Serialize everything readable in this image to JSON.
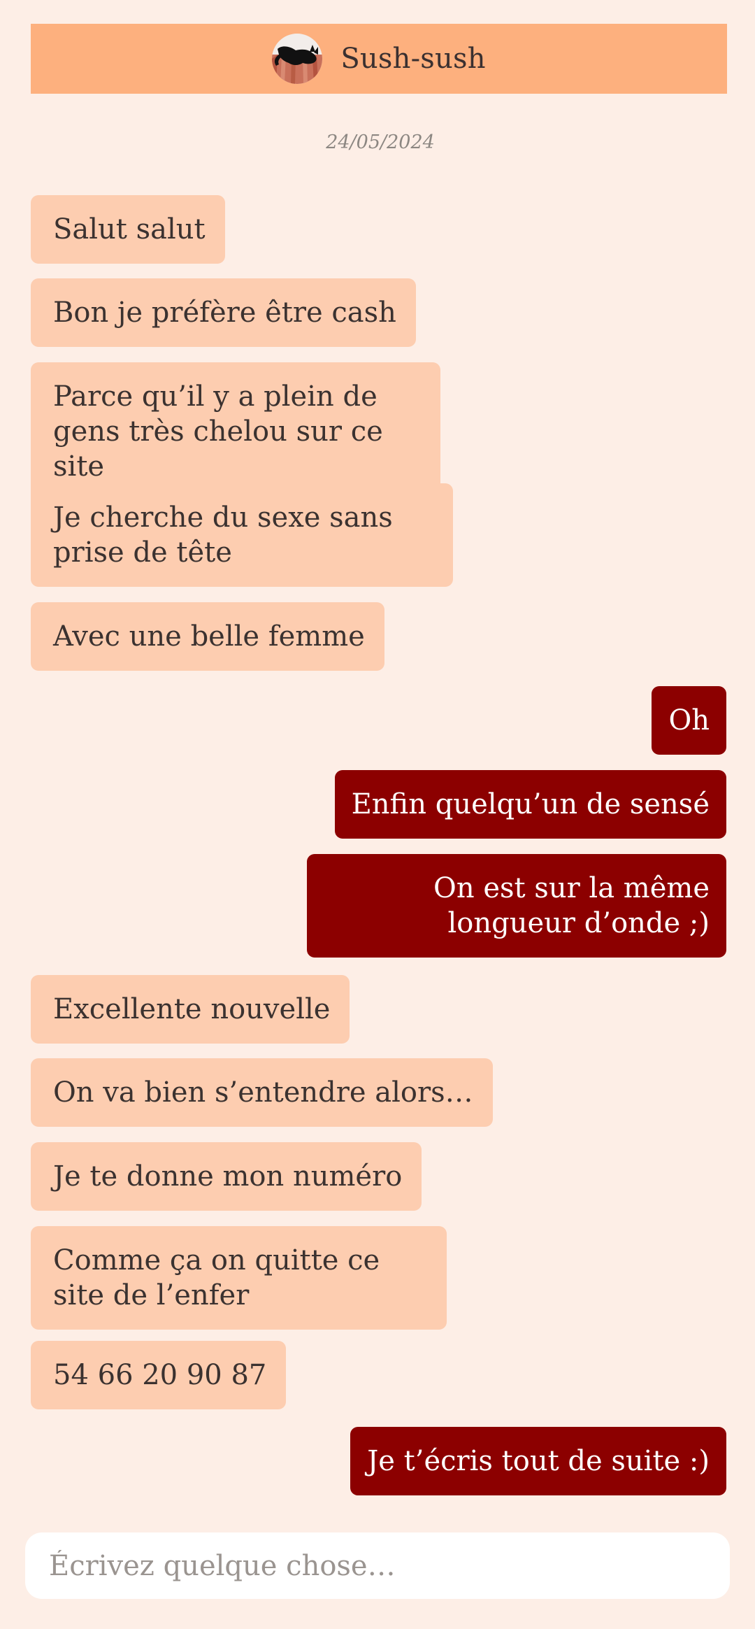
{
  "header": {
    "contact_name": "Sush-sush",
    "avatar_icon": "cat-avatar-icon"
  },
  "conversation": {
    "date": "24/05/2024",
    "messages": [
      {
        "from": "them",
        "text": "Salut salut"
      },
      {
        "from": "them",
        "text": "Bon je préfère être cash"
      },
      {
        "from": "them",
        "text": "Parce qu’il y a plein de gens très chelou sur ce site"
      },
      {
        "from": "them",
        "text": "Je cherche du sexe sans prise de tête"
      },
      {
        "from": "them",
        "text": "Avec une belle femme"
      },
      {
        "from": "me",
        "text": "Oh"
      },
      {
        "from": "me",
        "text": "Enfin quelqu’un de sensé"
      },
      {
        "from": "me",
        "text": "On est sur la même longueur d’onde ;)"
      },
      {
        "from": "them",
        "text": "Excellente nouvelle"
      },
      {
        "from": "them",
        "text": "On va bien s’entendre alors…"
      },
      {
        "from": "them",
        "text": "Je te donne mon numéro"
      },
      {
        "from": "them",
        "text": "Comme ça on quitte ce site de l’enfer"
      },
      {
        "from": "them",
        "text": "54 66 20 90 87"
      },
      {
        "from": "me",
        "text": "Je t’écris tout de suite :)"
      }
    ]
  },
  "composer": {
    "placeholder": "Écrivez quelque chose…",
    "value": ""
  },
  "colors": {
    "background": "#FDEEE6",
    "header": "#FDB07E",
    "incoming_bubble": "#FDCDB0",
    "outgoing_bubble": "#8C0000"
  }
}
